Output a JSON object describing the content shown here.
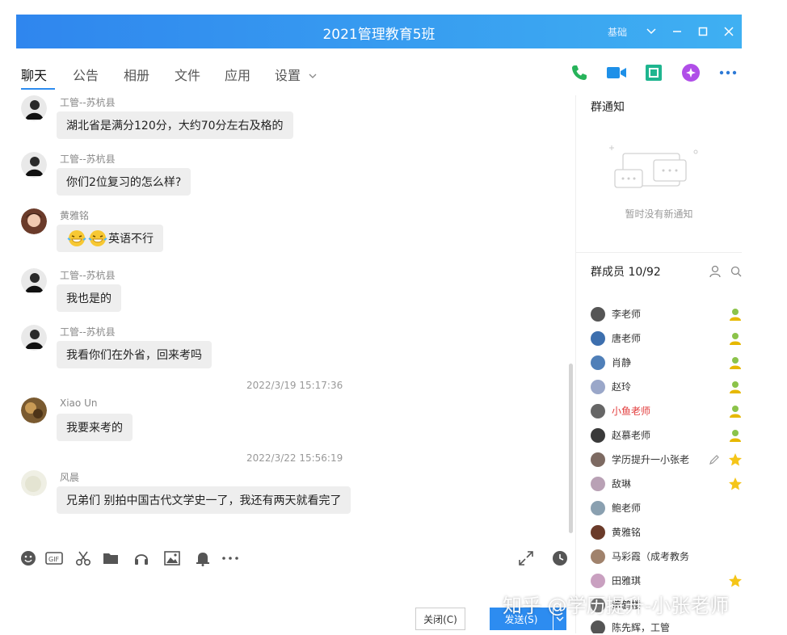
{
  "window": {
    "title": "2021管理教育5班",
    "title_right_text": "基础"
  },
  "tabs": [
    {
      "label": "聊天"
    },
    {
      "label": "公告"
    },
    {
      "label": "相册"
    },
    {
      "label": "文件"
    },
    {
      "label": "应用"
    },
    {
      "label": "设置"
    }
  ],
  "messages": [
    {
      "sender": "工管--苏杭县",
      "text": "湖北省是满分120分，大约70分左右及格的"
    },
    {
      "sender": "工管--苏杭县",
      "text": "你们2位复习的怎么样?"
    },
    {
      "sender": "黄雅铭",
      "text": "英语不行"
    },
    {
      "sender": "工管--苏杭县",
      "text": "我也是的"
    },
    {
      "sender": "工管--苏杭县",
      "text": "我看你们在外省，回来考吗"
    },
    {
      "sender": "Xiao Un",
      "text": "我要来考的"
    },
    {
      "sender": "风晨",
      "text": "兄弟们 别拍中国古代文学史一了，我还有两天就看完了"
    }
  ],
  "timestamps": [
    "2022/3/19 15:17:36",
    "2022/3/22 15:56:19"
  ],
  "buttons": {
    "close": "关闭(C)",
    "send": "发送(S)"
  },
  "sidebar": {
    "notice_title": "群通知",
    "notice_empty": "暂时没有新通知",
    "members_label": "群成员 10/92",
    "members": [
      {
        "name": "李老师",
        "color": "#333333"
      },
      {
        "name": "唐老师",
        "color": "#333333"
      },
      {
        "name": "肖静",
        "color": "#333333"
      },
      {
        "name": "赵玲",
        "color": "#333333"
      },
      {
        "name": "小鱼老师",
        "color": "#e23b3b"
      },
      {
        "name": "赵慕老师",
        "color": "#333333"
      },
      {
        "name": "学历提升一小张老",
        "color": "#333333"
      },
      {
        "name": "敌琳",
        "color": "#333333"
      },
      {
        "name": "鲍老师",
        "color": "#333333"
      },
      {
        "name": "黄雅铭",
        "color": "#333333"
      },
      {
        "name": "马彩霞（成考教务",
        "color": "#333333"
      },
      {
        "name": "田雅琪",
        "color": "#333333"
      },
      {
        "name": "黄鹤楼",
        "color": "#333333"
      },
      {
        "name": "陈先辉，工管",
        "color": "#333333"
      }
    ]
  },
  "watermark": "知乎 @学历提升-小张老师"
}
